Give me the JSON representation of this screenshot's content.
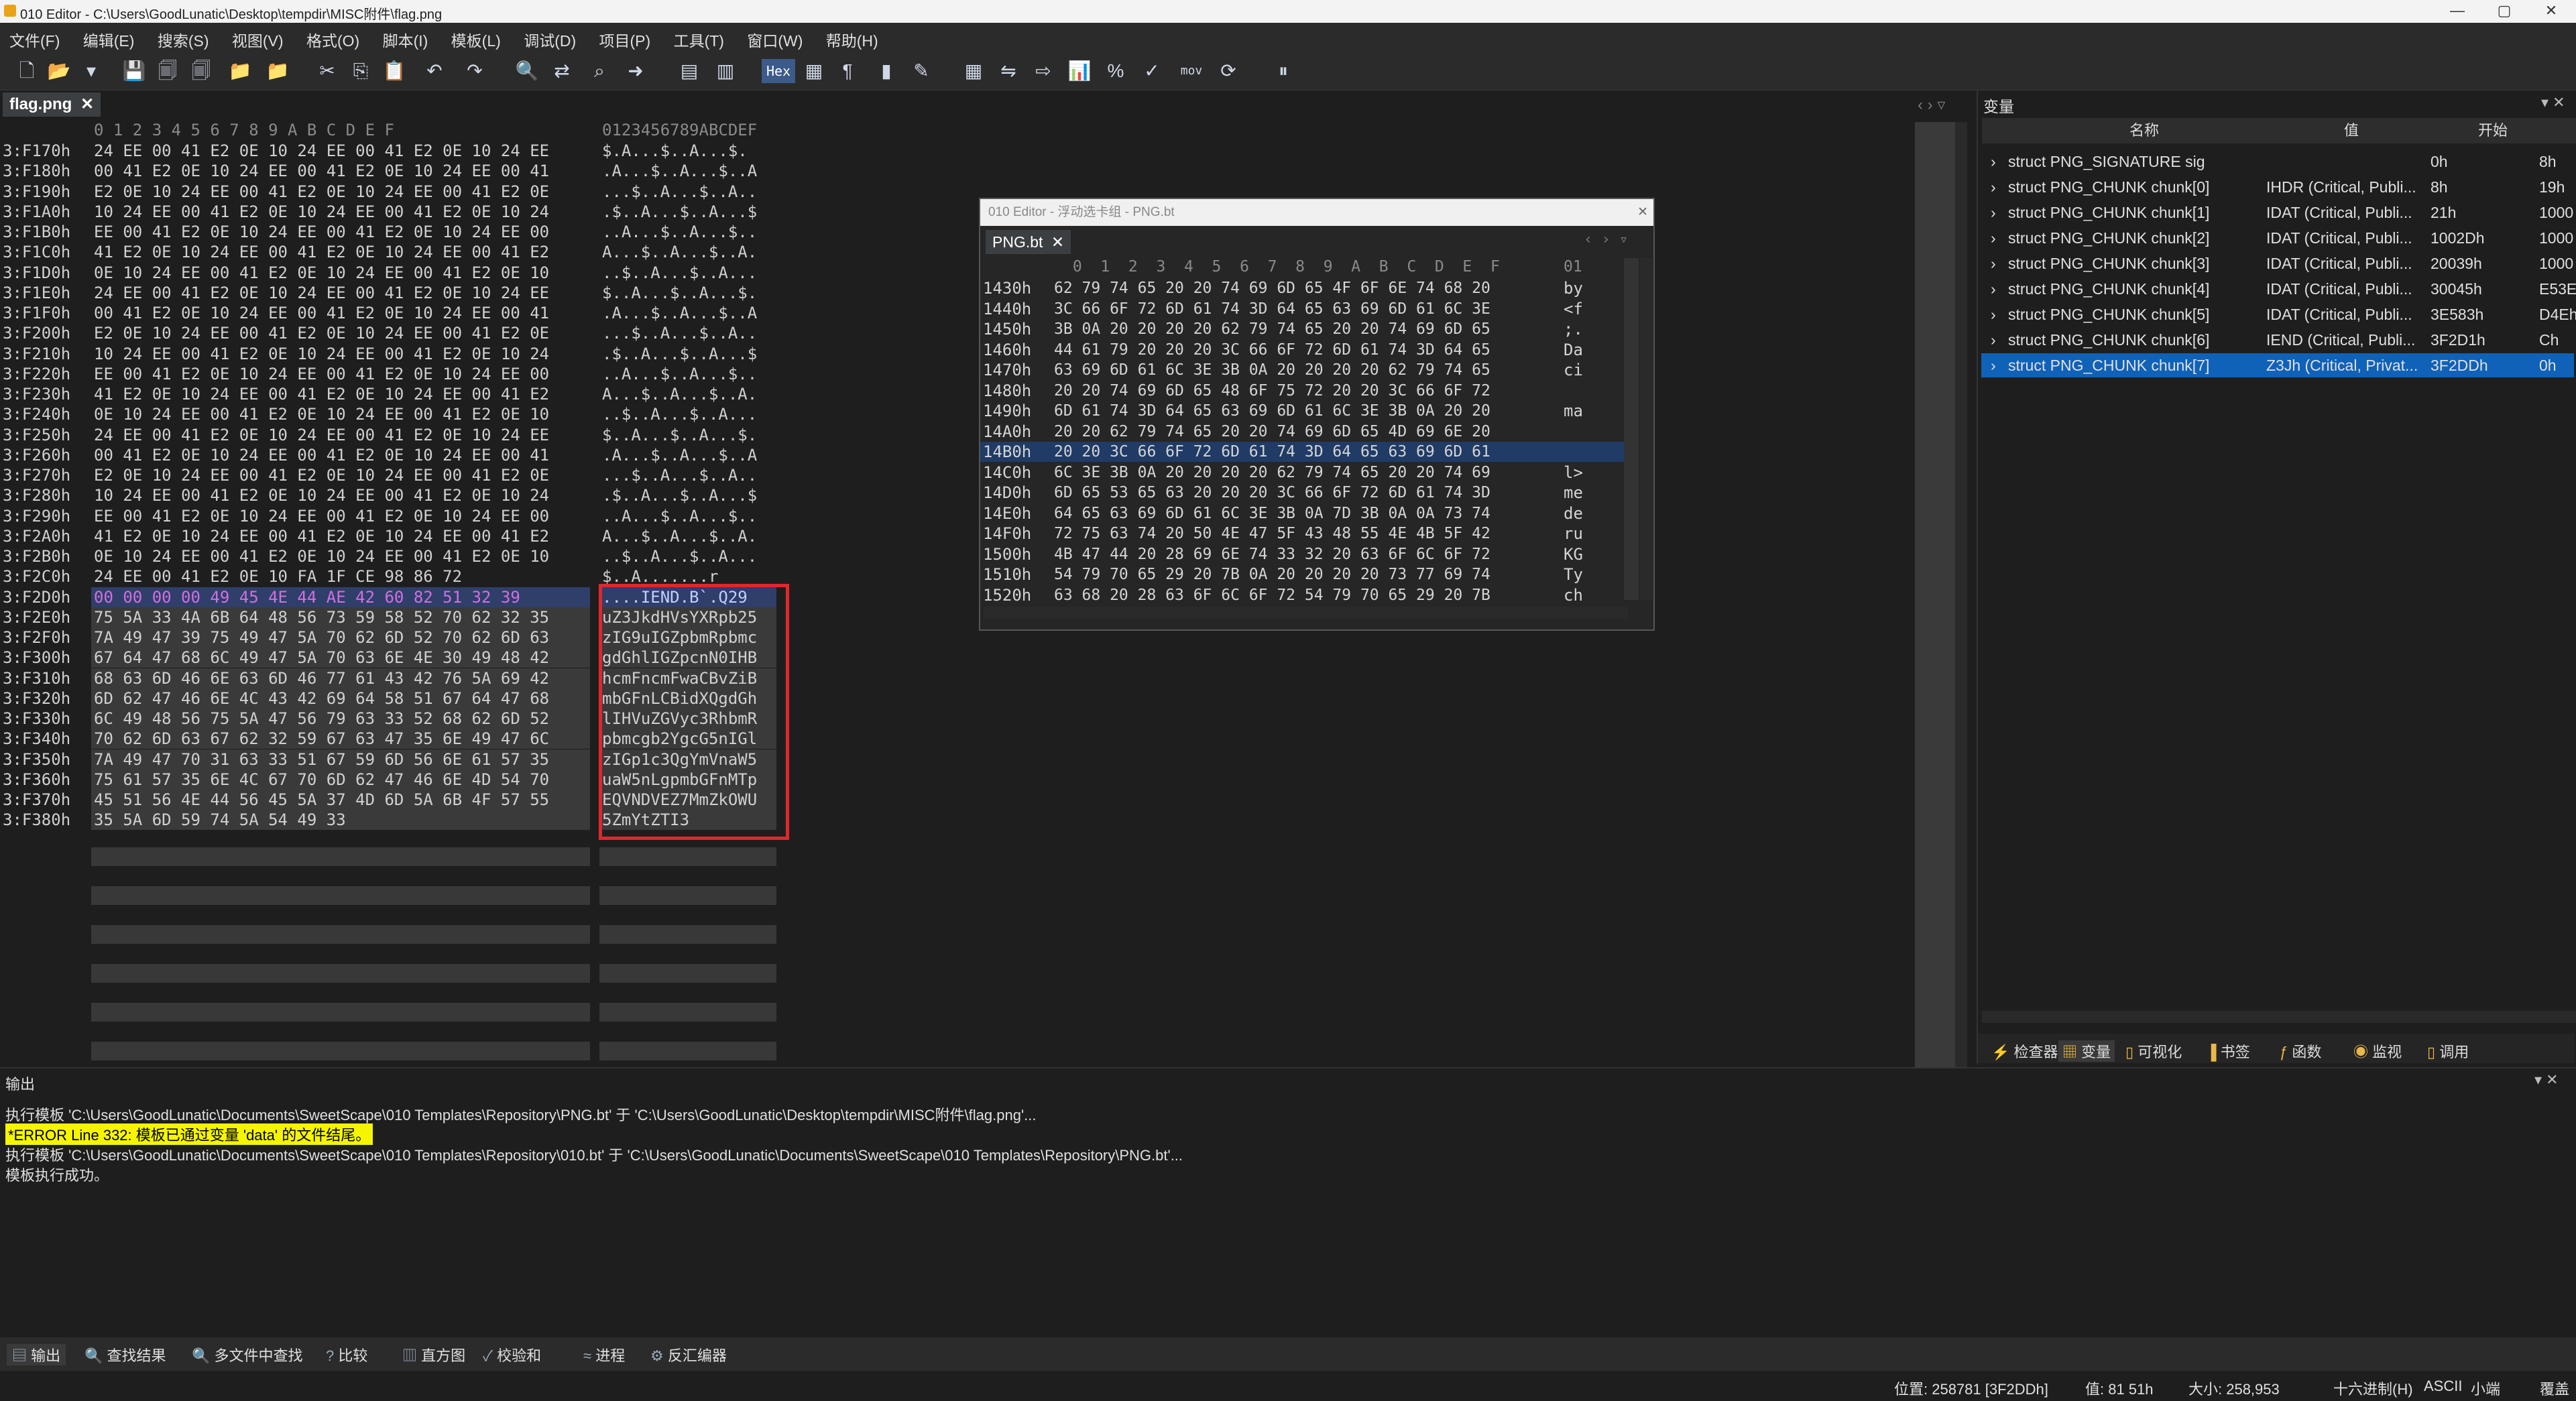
{
  "window": {
    "title": "010 Editor - C:\\Users\\GoodLunatic\\Desktop\\tempdir\\MISC附件\\flag.png"
  },
  "menu": [
    "文件(F)",
    "编辑(E)",
    "搜索(S)",
    "视图(V)",
    "格式(O)",
    "脚本(I)",
    "模板(L)",
    "调试(D)",
    "项目(P)",
    "工具(T)",
    "窗口(W)",
    "帮助(H)"
  ],
  "toolbar": {
    "hex_label": "Hex",
    "mov_label": "mov"
  },
  "file_tab": "flag.png",
  "hex": {
    "header_hex": " 0  1  2  3  4  5  6  7  8  9  A  B  C  D  E  F",
    "header_ascii": "0123456789ABCDEF",
    "rows": [
      {
        "a": "3:F170h",
        "h": "24 EE 00 41 E2 0E 10 24 EE 00 41 E2 0E 10 24 EE",
        "s": "$.A...$..A...$."
      },
      {
        "a": "3:F180h",
        "h": "00 41 E2 0E 10 24 EE 00 41 E2 0E 10 24 EE 00 41",
        "s": ".A...$..A...$..A"
      },
      {
        "a": "3:F190h",
        "h": "E2 0E 10 24 EE 00 41 E2 0E 10 24 EE 00 41 E2 0E",
        "s": "...$..A...$..A.."
      },
      {
        "a": "3:F1A0h",
        "h": "10 24 EE 00 41 E2 0E 10 24 EE 00 41 E2 0E 10 24",
        "s": ".$..A...$..A...$"
      },
      {
        "a": "3:F1B0h",
        "h": "EE 00 41 E2 0E 10 24 EE 00 41 E2 0E 10 24 EE 00",
        "s": "..A...$..A...$.."
      },
      {
        "a": "3:F1C0h",
        "h": "41 E2 0E 10 24 EE 00 41 E2 0E 10 24 EE 00 41 E2",
        "s": "A...$..A...$..A."
      },
      {
        "a": "3:F1D0h",
        "h": "0E 10 24 EE 00 41 E2 0E 10 24 EE 00 41 E2 0E 10",
        "s": "..$..A...$..A..."
      },
      {
        "a": "3:F1E0h",
        "h": "24 EE 00 41 E2 0E 10 24 EE 00 41 E2 0E 10 24 EE",
        "s": "$..A...$..A...$."
      },
      {
        "a": "3:F1F0h",
        "h": "00 41 E2 0E 10 24 EE 00 41 E2 0E 10 24 EE 00 41",
        "s": ".A...$..A...$..A"
      },
      {
        "a": "3:F200h",
        "h": "E2 0E 10 24 EE 00 41 E2 0E 10 24 EE 00 41 E2 0E",
        "s": "...$..A...$..A.."
      },
      {
        "a": "3:F210h",
        "h": "10 24 EE 00 41 E2 0E 10 24 EE 00 41 E2 0E 10 24",
        "s": ".$..A...$..A...$"
      },
      {
        "a": "3:F220h",
        "h": "EE 00 41 E2 0E 10 24 EE 00 41 E2 0E 10 24 EE 00",
        "s": "..A...$..A...$.."
      },
      {
        "a": "3:F230h",
        "h": "41 E2 0E 10 24 EE 00 41 E2 0E 10 24 EE 00 41 E2",
        "s": "A...$..A...$..A."
      },
      {
        "a": "3:F240h",
        "h": "0E 10 24 EE 00 41 E2 0E 10 24 EE 00 41 E2 0E 10",
        "s": "..$..A...$..A..."
      },
      {
        "a": "3:F250h",
        "h": "24 EE 00 41 E2 0E 10 24 EE 00 41 E2 0E 10 24 EE",
        "s": "$..A...$..A...$."
      },
      {
        "a": "3:F260h",
        "h": "00 41 E2 0E 10 24 EE 00 41 E2 0E 10 24 EE 00 41",
        "s": ".A...$..A...$..A"
      },
      {
        "a": "3:F270h",
        "h": "E2 0E 10 24 EE 00 41 E2 0E 10 24 EE 00 41 E2 0E",
        "s": "...$..A...$..A.."
      },
      {
        "a": "3:F280h",
        "h": "10 24 EE 00 41 E2 0E 10 24 EE 00 41 E2 0E 10 24",
        "s": ".$..A...$..A...$"
      },
      {
        "a": "3:F290h",
        "h": "EE 00 41 E2 0E 10 24 EE 00 41 E2 0E 10 24 EE 00",
        "s": "..A...$..A...$.."
      },
      {
        "a": "3:F2A0h",
        "h": "41 E2 0E 10 24 EE 00 41 E2 0E 10 24 EE 00 41 E2",
        "s": "A...$..A...$..A."
      },
      {
        "a": "3:F2B0h",
        "h": "0E 10 24 EE 00 41 E2 0E 10 24 EE 00 41 E2 0E 10",
        "s": "..$..A...$..A..."
      },
      {
        "a": "3:F2C0h",
        "h": "24 EE 00 41 E2 0E 10 FA 1F CE 98 86 72",
        "s": "$..A.......r"
      },
      {
        "a": "3:F2D0h",
        "h": "00 00 00 00 49 45 4E 44 AE 42 60 82 51 32 39",
        "s": "....IEND.B`.Q29"
      },
      {
        "a": "3:F2E0h",
        "h": "75 5A 33 4A 6B 64 48 56 73 59 58 52 70 62 32 35",
        "s": "uZ3JkdHVsYXRpb25"
      },
      {
        "a": "3:F2F0h",
        "h": "7A 49 47 39 75 49 47 5A 70 62 6D 52 70 62 6D 63",
        "s": "zIG9uIGZpbmRpbmc"
      },
      {
        "a": "3:F300h",
        "h": "67 64 47 68 6C 49 47 5A 70 63 6E 4E 30 49 48 42",
        "s": "gdGhlIGZpcnN0IHB"
      },
      {
        "a": "3:F310h",
        "h": "68 63 6D 46 6E 63 6D 46 77 61 43 42 76 5A 69 42",
        "s": "hcmFncmFwaCBvZiB"
      },
      {
        "a": "3:F320h",
        "h": "6D 62 47 46 6E 4C 43 42 69 64 58 51 67 64 47 68",
        "s": "mbGFnLCBidXQgdGh"
      },
      {
        "a": "3:F330h",
        "h": "6C 49 48 56 75 5A 47 56 79 63 33 52 68 62 6D 52",
        "s": "lIHVuZGVyc3RhbmR"
      },
      {
        "a": "3:F340h",
        "h": "70 62 6D 63 67 62 32 59 67 63 47 35 6E 49 47 6C",
        "s": "pbmcgb2YgcG5nIGl"
      },
      {
        "a": "3:F350h",
        "h": "7A 49 47 70 31 63 33 51 67 59 6D 56 6E 61 57 35",
        "s": "zIGp1c3QgYmVnaW5"
      },
      {
        "a": "3:F360h",
        "h": "75 61 57 35 6E 4C 67 70 6D 62 47 46 6E 4D 54 70",
        "s": "uaW5nLgpmbGFnMTp"
      },
      {
        "a": "3:F370h",
        "h": "45 51 56 4E 44 56 45 5A 37 4D 6D 5A 6B 4F 57 55",
        "s": "EQVNDVEZ7MmZkOWU"
      },
      {
        "a": "3:F380h",
        "h": "35 5A 6D 59 74 5A 54 49 33",
        "s": "5ZmYtZTI3"
      }
    ]
  },
  "float": {
    "title": "010 Editor - 浮动选卡组 - PNG.bt",
    "tab": "PNG.bt",
    "header_hex": " 0  1  2  3  4  5  6  7  8  9  A  B  C  D  E  F",
    "header_ascii": "01",
    "rows": [
      {
        "a": "1430h",
        "h": "62 79 74 65 20 20 74 69 6D 65 4F 6F 6E 74 68 20",
        "s": "by"
      },
      {
        "a": "1440h",
        "h": "3C 66 6F 72 6D 61 74 3D 64 65 63 69 6D 61 6C 3E",
        "s": "<f"
      },
      {
        "a": "1450h",
        "h": "3B 0A 20 20 20 20 62 79 74 65 20 20 74 69 6D 65",
        "s": ";."
      },
      {
        "a": "1460h",
        "h": "44 61 79 20 20 20 3C 66 6F 72 6D 61 74 3D 64 65",
        "s": "Da"
      },
      {
        "a": "1470h",
        "h": "63 69 6D 61 6C 3E 3B 0A 20 20 20 20 62 79 74 65",
        "s": "ci"
      },
      {
        "a": "1480h",
        "h": "20 20 74 69 6D 65 48 6F 75 72 20 20 3C 66 6F 72",
        "s": ""
      },
      {
        "a": "1490h",
        "h": "6D 61 74 3D 64 65 63 69 6D 61 6C 3E 3B 0A 20 20",
        "s": "ma"
      },
      {
        "a": "14A0h",
        "h": "20 20 62 79 74 65 20 20 74 69 6D 65 4D 69 6E 20",
        "s": ""
      },
      {
        "a": "14B0h",
        "h": "20 20 3C 66 6F 72 6D 61 74 3D 64 65 63 69 6D 61",
        "s": ""
      },
      {
        "a": "14C0h",
        "h": "6C 3E 3B 0A 20 20 20 20 62 79 74 65 20 20 74 69",
        "s": "l>"
      },
      {
        "a": "14D0h",
        "h": "6D 65 53 65 63 20 20 20 3C 66 6F 72 6D 61 74 3D",
        "s": "me"
      },
      {
        "a": "14E0h",
        "h": "64 65 63 69 6D 61 6C 3E 3B 0A 7D 3B 0A 0A 73 74",
        "s": "de"
      },
      {
        "a": "14F0h",
        "h": "72 75 63 74 20 50 4E 47 5F 43 48 55 4E 4B 5F 42",
        "s": "ru"
      },
      {
        "a": "1500h",
        "h": "4B 47 44 20 28 69 6E 74 33 32 20 63 6F 6C 6F 72",
        "s": "KG"
      },
      {
        "a": "1510h",
        "h": "54 79 70 65 29 20 7B 0A 20 20 20 20 73 77 69 74",
        "s": "Ty"
      },
      {
        "a": "1520h",
        "h": "63 68 20 28 63 6F 6C 6F 72 54 79 70 65 29 20 7B",
        "s": "ch"
      }
    ]
  },
  "vars": {
    "panel_title": "变量",
    "col_name": "名称",
    "col_value": "值",
    "col_start": "开始",
    "rows": [
      {
        "name": "struct PNG_SIGNATURE sig",
        "value": "",
        "start": "0h",
        "size": "8h"
      },
      {
        "name": "struct PNG_CHUNK chunk[0]",
        "value": "IHDR  (Critical, Publi...",
        "start": "8h",
        "size": "19h"
      },
      {
        "name": "struct PNG_CHUNK chunk[1]",
        "value": "IDAT  (Critical, Publi...",
        "start": "21h",
        "size": "1000"
      },
      {
        "name": "struct PNG_CHUNK chunk[2]",
        "value": "IDAT  (Critical, Publi...",
        "start": "1002Dh",
        "size": "1000"
      },
      {
        "name": "struct PNG_CHUNK chunk[3]",
        "value": "IDAT  (Critical, Publi...",
        "start": "20039h",
        "size": "1000"
      },
      {
        "name": "struct PNG_CHUNK chunk[4]",
        "value": "IDAT  (Critical, Publi...",
        "start": "30045h",
        "size": "E53E"
      },
      {
        "name": "struct PNG_CHUNK chunk[5]",
        "value": "IDAT  (Critical, Publi...",
        "start": "3E583h",
        "size": "D4Eh"
      },
      {
        "name": "struct PNG_CHUNK chunk[6]",
        "value": "IEND  (Critical, Publi...",
        "start": "3F2D1h",
        "size": "Ch"
      },
      {
        "name": "struct PNG_CHUNK chunk[7]",
        "value": "Z3Jh  (Critical, Privat...",
        "start": "3F2DDh",
        "size": "0h"
      }
    ],
    "tabs": [
      "检查器",
      "变量",
      "可视化",
      "书签",
      "函数",
      "监视",
      "调用"
    ]
  },
  "output": {
    "title": "输出",
    "lines": [
      "执行模板 'C:\\Users\\GoodLunatic\\Documents\\SweetScape\\010 Templates\\Repository\\PNG.bt' 于 'C:\\Users\\GoodLunatic\\Desktop\\tempdir\\MISC附件\\flag.png'...",
      "*ERROR Line 332: 模板已通过变量 'data' 的文件结尾。",
      "执行模板 'C:\\Users\\GoodLunatic\\Documents\\SweetScape\\010 Templates\\Repository\\010.bt' 于 'C:\\Users\\GoodLunatic\\Documents\\SweetScape\\010 Templates\\Repository\\PNG.bt'...",
      "模板执行成功。"
    ]
  },
  "bottom_tabs": [
    "输出",
    "查找结果",
    "多文件中查找",
    "比较",
    "直方图",
    "校验和",
    "进程",
    "反汇编器"
  ],
  "status": {
    "pos": "位置: 258781 [3F2DDh]",
    "val": "值: 81 51h",
    "size": "大小: 258,953",
    "mode": "十六进制(H)",
    "charset": "ASCII",
    "endian": "小端",
    "overwrite": "覆盖"
  }
}
